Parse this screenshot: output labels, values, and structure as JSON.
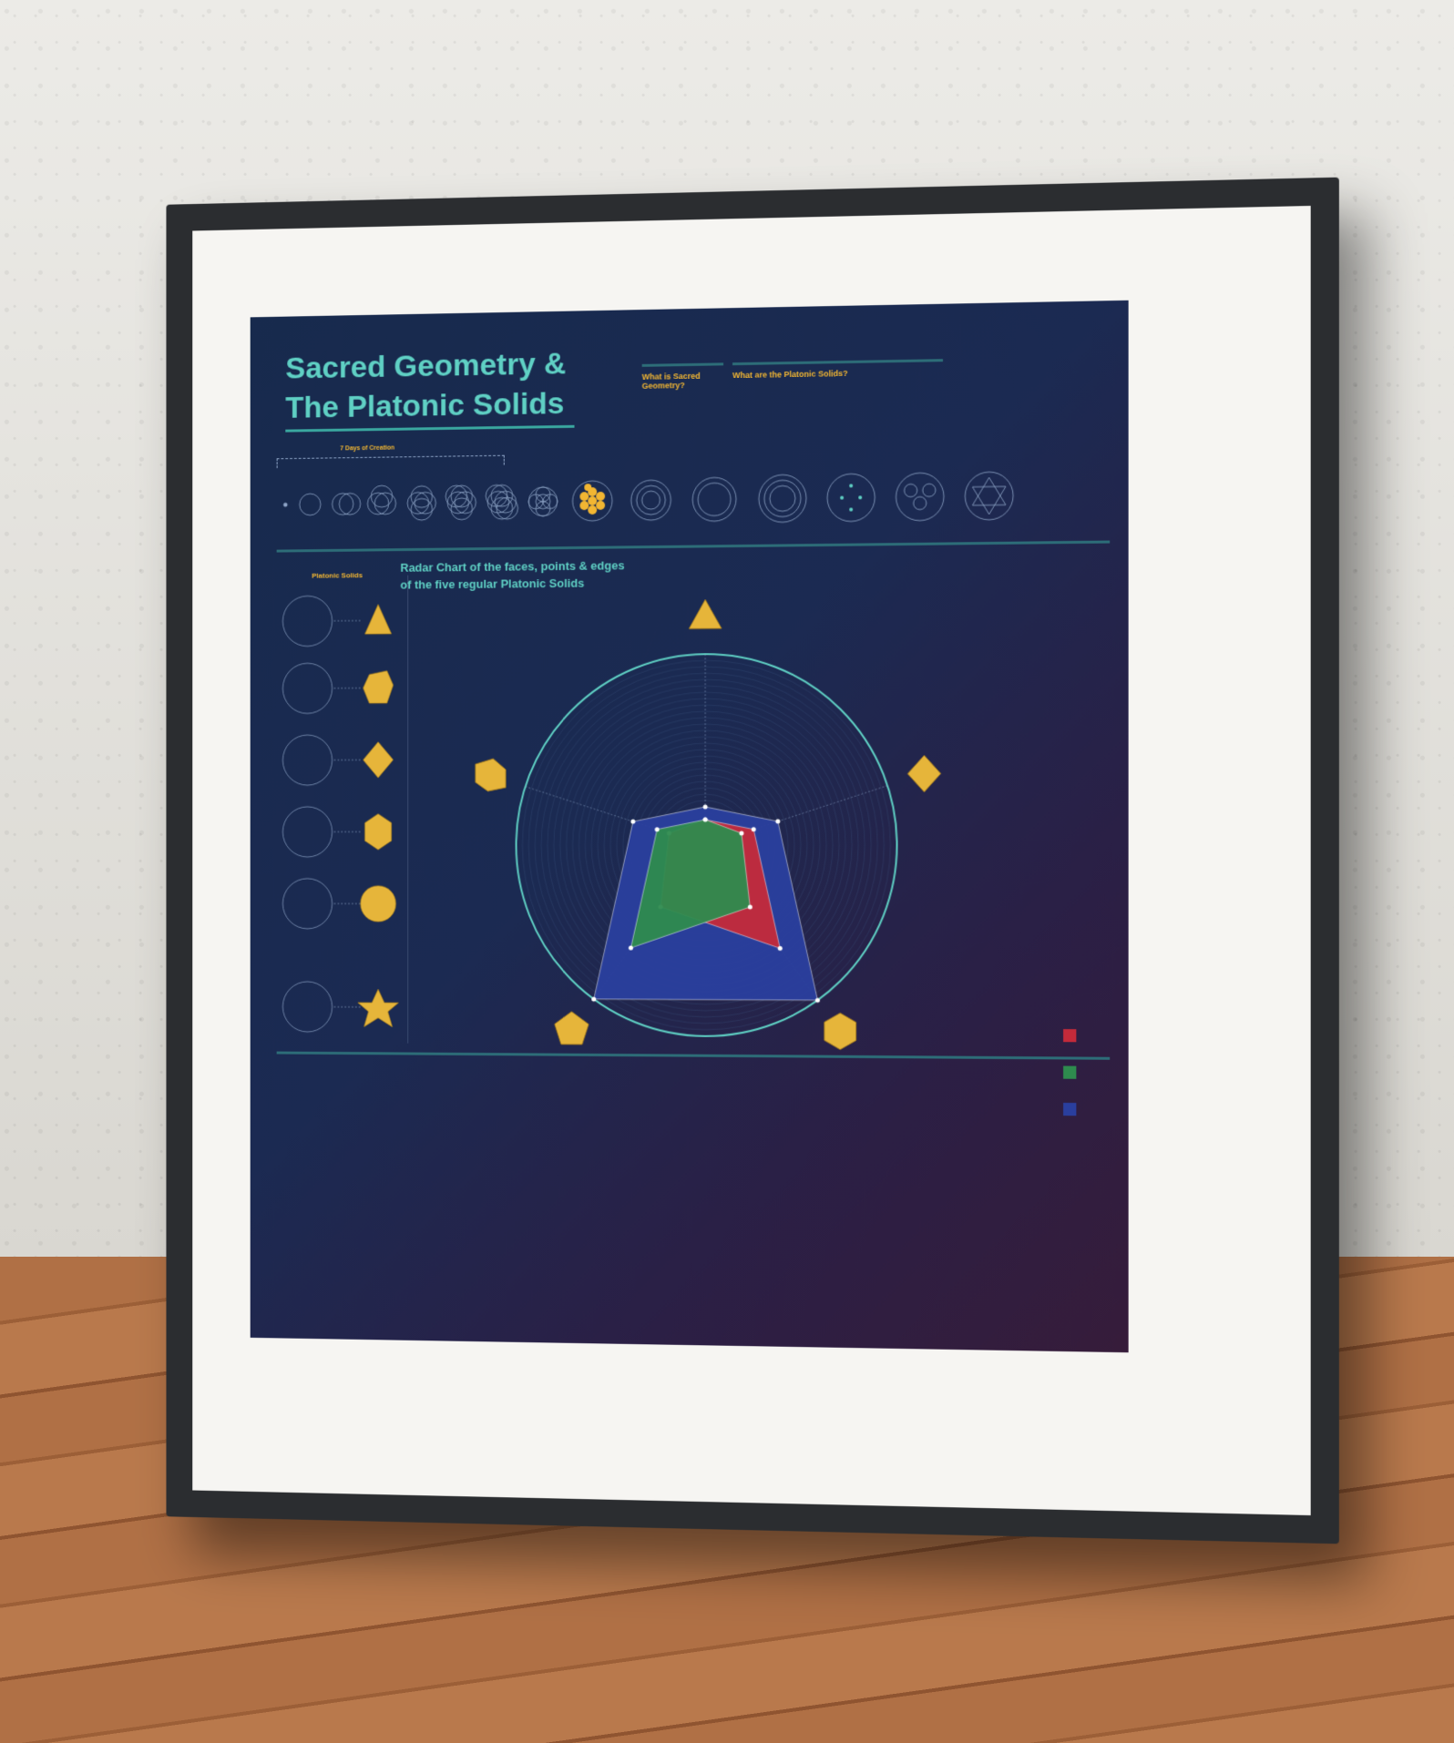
{
  "poster": {
    "title_line1": "Sacred Geometry &",
    "title_line2": "The Platonic Solids",
    "sections": {
      "what_is_sacred_geometry": "What is Sacred Geometry?",
      "what_are_platonic_solids": "What are the Platonic Solids?",
      "seven_days": "7 Days of Creation",
      "platonic_solids": "Platonic Solids"
    },
    "radar_title_line1": "Radar Chart of the faces, points & edges",
    "radar_title_line2": "of the five regular Platonic Solids"
  },
  "chart_data": {
    "type": "radar",
    "title": "Radar Chart of the faces, points & edges of the five regular Platonic Solids",
    "categories": [
      "Tetrahedron",
      "Octahedron",
      "Icosahedron",
      "Dodecahedron",
      "Hexahedron"
    ],
    "series": [
      {
        "color": "#c42a3a",
        "values": [
          4,
          8,
          20,
          12,
          6
        ]
      },
      {
        "color": "#2e8b4e",
        "values": [
          4,
          6,
          12,
          20,
          8
        ]
      },
      {
        "color": "#2a3f9e",
        "values": [
          6,
          12,
          30,
          30,
          12
        ]
      }
    ],
    "legend_position": "bottom-right"
  },
  "colors": {
    "accent_teal": "#5fd0c4",
    "accent_gold": "#f2b632",
    "background_top": "#172a4d",
    "background_bottom": "#361c3a"
  }
}
